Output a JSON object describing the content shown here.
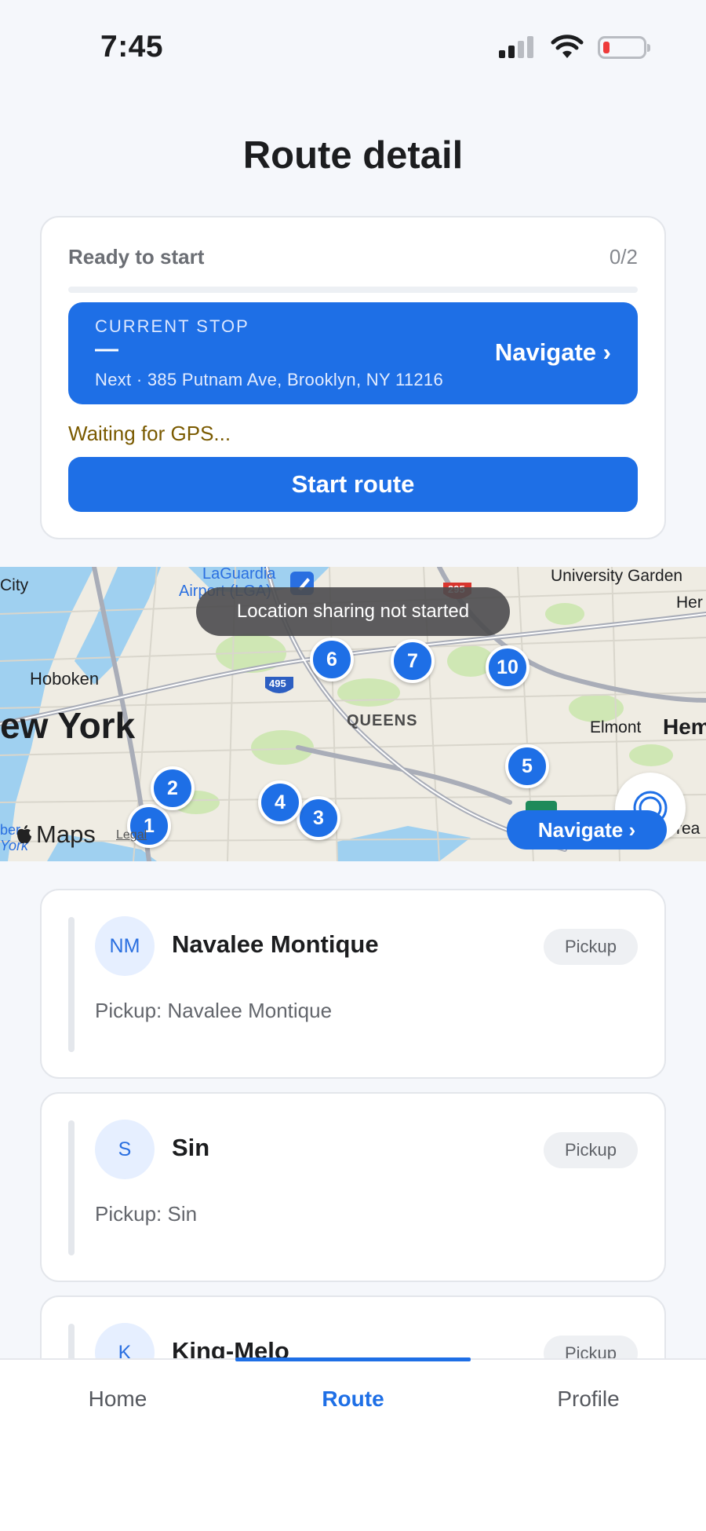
{
  "status_bar": {
    "time": "7:45",
    "battery_level": 0.1
  },
  "header": {
    "title": "Route detail"
  },
  "route": {
    "status": "Ready to start",
    "progress_label": "0/2",
    "progress_fraction": 0,
    "current_stop": {
      "label": "CURRENT STOP",
      "value": "—",
      "next": "Next · 385 Putnam Ave, Brooklyn, NY 11216",
      "navigate_label": "Navigate ›"
    },
    "gps_status": "Waiting for GPS...",
    "start_button_label": "Start route"
  },
  "map": {
    "toast": "Location sharing not started",
    "labels": {
      "laguardia": "LaGuardia",
      "airport": "Airport (LGA)",
      "university": "University Garden",
      "her": "Her",
      "city": "City",
      "hoboken": "Hoboken",
      "new_york": "ew York",
      "queens": "QUEENS",
      "elmont": "Elmont",
      "hem": "Hem",
      "rea": "rea",
      "york_small": "York",
      "ber": "ber",
      "hwy_295": "295",
      "hwy_495": "495"
    },
    "pins": [
      "1",
      "2",
      "3",
      "4",
      "5",
      "6",
      "7",
      "10"
    ],
    "attribution": "Maps",
    "legal": "Legal",
    "navigate_label": "Navigate ›"
  },
  "stops": [
    {
      "initials": "NM",
      "name": "Navalee Montique",
      "type": "Pickup",
      "detail": "Pickup: Navalee Montique"
    },
    {
      "initials": "S",
      "name": "Sin",
      "type": "Pickup",
      "detail": "Pickup: Sin"
    },
    {
      "initials": "K",
      "name": "King-Melo",
      "type": "Pickup",
      "detail": ""
    }
  ],
  "tabs": [
    {
      "label": "Home",
      "active": false
    },
    {
      "label": "Route",
      "active": true
    },
    {
      "label": "Profile",
      "active": false
    }
  ],
  "colors": {
    "accent": "#1e6fe6",
    "gps_warning": "#7a5a00",
    "battery_low": "#ee3b3b"
  }
}
